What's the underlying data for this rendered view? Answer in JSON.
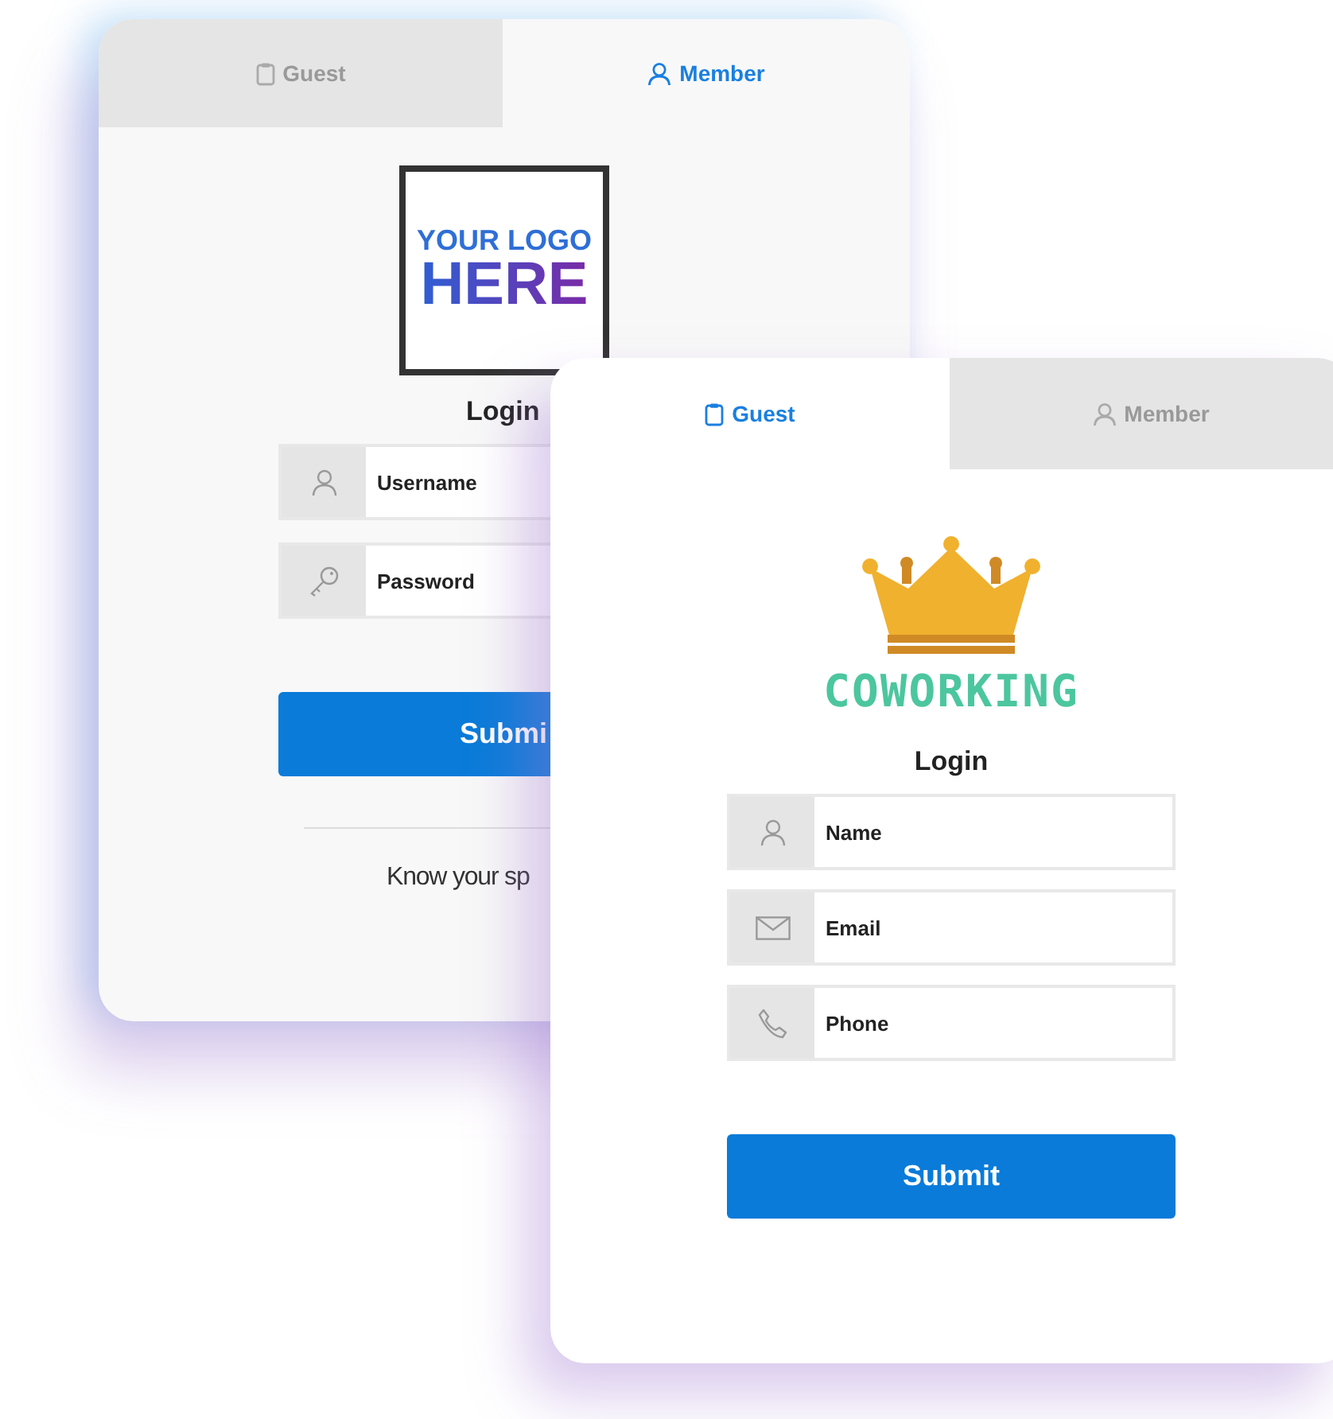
{
  "cards": [
    {
      "tabs": [
        {
          "label": "Guest",
          "selected": false
        },
        {
          "label": "Member",
          "selected": true
        }
      ],
      "logo": {
        "kind": "text-logo",
        "lines": [
          "YOUR LOGO",
          "HERE"
        ]
      },
      "title": "Login",
      "fields": [
        {
          "kind": "name",
          "placeholder": "Username"
        },
        {
          "kind": "password",
          "placeholder": "Password"
        }
      ],
      "submit": "Submi",
      "footer": "Know your sp"
    },
    {
      "tabs": [
        {
          "label": "Guest",
          "selected": true
        },
        {
          "label": "Member",
          "selected": false
        }
      ],
      "logo": {
        "kind": "crown",
        "lines": [
          "COWORKING"
        ]
      },
      "title": "Login",
      "fields": [
        {
          "kind": "name",
          "placeholder": "Name"
        },
        {
          "kind": "email",
          "placeholder": "Email"
        },
        {
          "kind": "phone",
          "placeholder": "Phone"
        }
      ],
      "submit": "Submit"
    }
  ]
}
